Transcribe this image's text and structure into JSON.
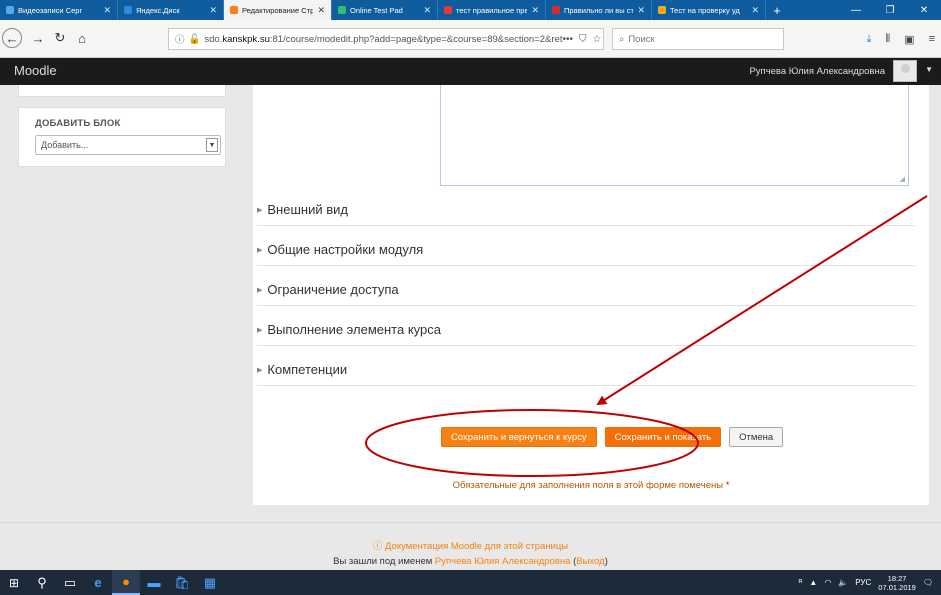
{
  "browser": {
    "tabs": [
      {
        "title": "Видеозаписи Серг",
        "color": "#5aa9e6",
        "active": false
      },
      {
        "title": "Яндекс.Диск",
        "color": "#2a8ce0",
        "active": false
      },
      {
        "title": "Редактирование Стр",
        "color": "#f98012",
        "active": true
      },
      {
        "title": "Online Test Pad",
        "color": "#2fbf71",
        "active": false
      },
      {
        "title": "тест правильное пре",
        "color": "#e53935",
        "active": false
      },
      {
        "title": "Правильно ли вы ст",
        "color": "#d32f2f",
        "active": false
      },
      {
        "title": "Тест на проверку уд",
        "color": "#f9a825",
        "active": false
      }
    ],
    "new_tab": "+",
    "url_prefix": "sdo.",
    "url_domain": "kanskpk.su",
    "url_rest": ":81/course/modedit.php?add=page&type=&course=89&section=2&ret",
    "search_placeholder": "Поиск"
  },
  "moodle": {
    "brand": "Moodle",
    "user_name": "Рупчева Юлия Александровна"
  },
  "sidebar": {
    "block_title": "ДОБАВИТЬ БЛОК",
    "select_value": "Добавить..."
  },
  "main": {
    "sections": [
      {
        "label": "Внешний вид"
      },
      {
        "label": "Общие настройки модуля"
      },
      {
        "label": "Ограничение доступа"
      },
      {
        "label": "Выполнение элемента курса"
      },
      {
        "label": "Компетенции"
      }
    ],
    "buttons": {
      "save_return": "Сохранить и вернуться к курсу",
      "save_show": "Сохранить и показать",
      "cancel": "Отмена"
    },
    "required_note": "Обязательные для заполнения поля в этой форме помечены",
    "required_star": "*"
  },
  "footer": {
    "docs_link": "Документация Moodle для этой страницы",
    "logged_in_prefix": "Вы зашли под именем",
    "logged_in_user": "Рупчева Юлия Александровна",
    "logout_open": "(",
    "logout": "Выход",
    "logout_close": ")"
  },
  "taskbar": {
    "language": "РУС",
    "time": "18:27",
    "date": "07.01.2019"
  },
  "colors": {
    "accent": "#f98012",
    "annotation": "#c00000"
  }
}
